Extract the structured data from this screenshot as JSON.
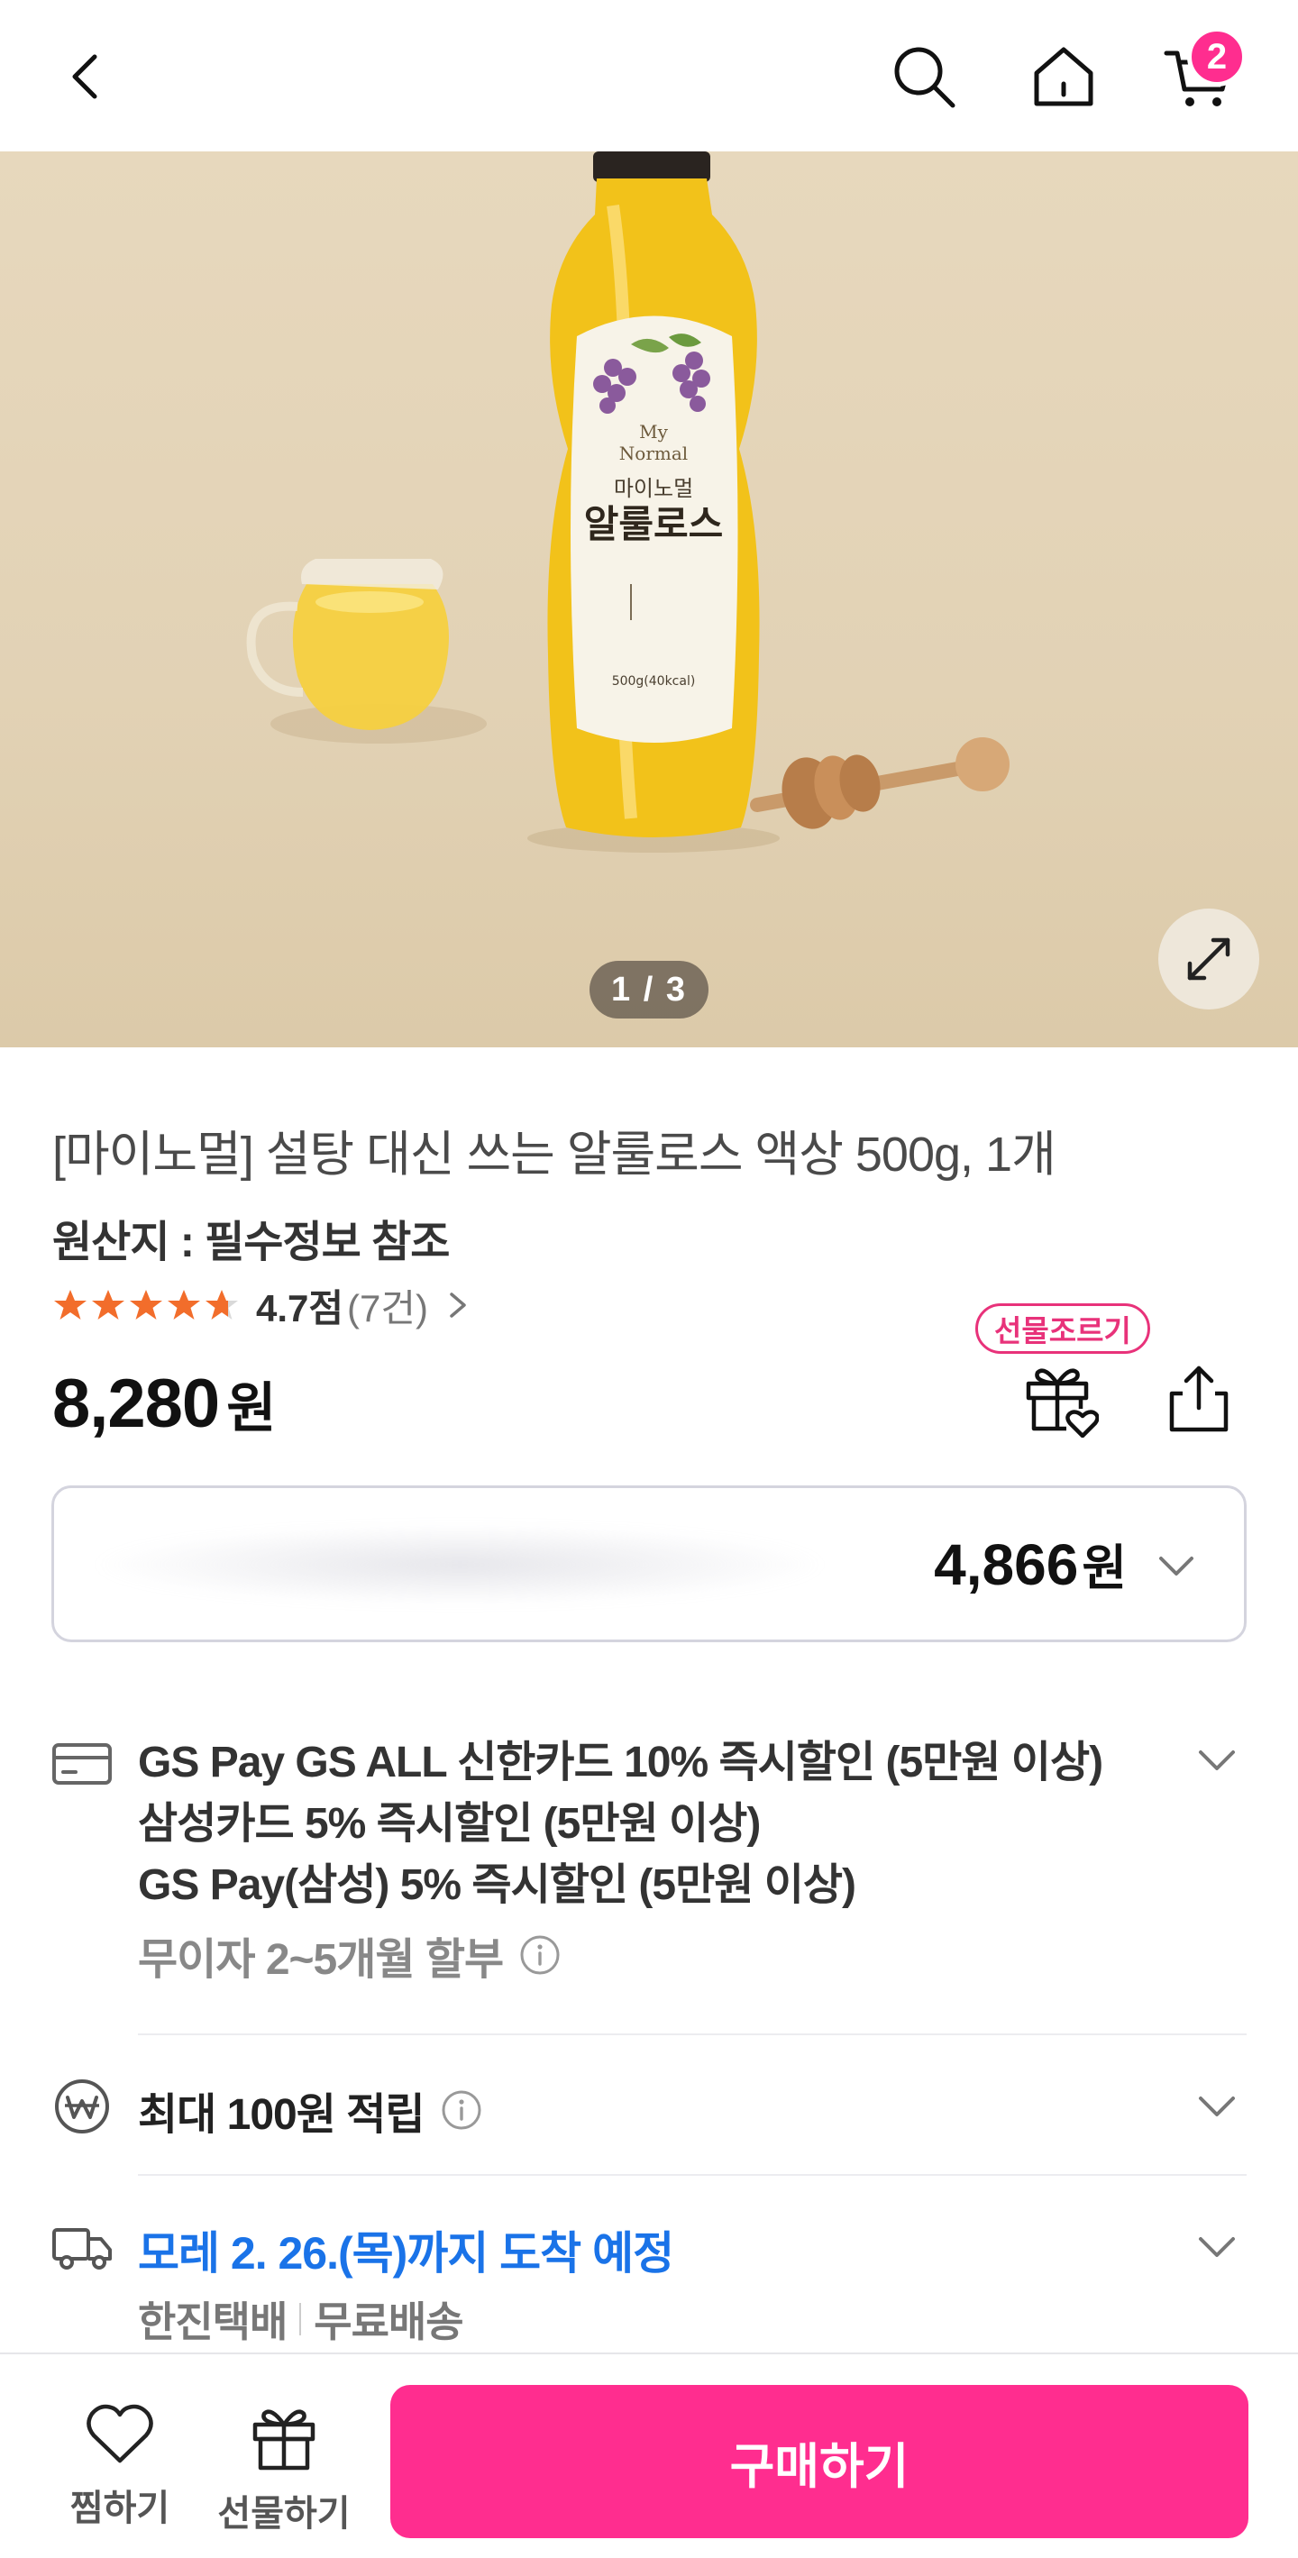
{
  "header": {
    "back_icon": "chevron-left-icon",
    "search_icon": "search-icon",
    "home_icon": "home-icon",
    "cart_icon": "cart-icon",
    "cart_count": "2"
  },
  "gallery": {
    "page_indicator": "1 / 3",
    "image_label_brand": "My\nNormal",
    "image_label_kr_small": "마이노멀",
    "image_label_kr_big": "알룰로스",
    "image_label_weight": "500g(40kcal)"
  },
  "product": {
    "title": "[마이노멀] 설탕 대신 쓰는 알룰로스 액상 500g, 1개",
    "origin": "원산지 : 필수정보 참조",
    "rating_score": "4.7점",
    "rating_count": "(7건)",
    "rating_value": 4.7,
    "rating_max": 5,
    "price": "8,280",
    "price_unit": "원",
    "gift_badge": "선물조르기"
  },
  "discount": {
    "price": "4,866",
    "unit": "원"
  },
  "benefits": {
    "card_lines": [
      "GS Pay GS ALL 신한카드 10% 즉시할인 (5만원 이상)",
      "삼성카드 5% 즉시할인 (5만원 이상)",
      "GS Pay(삼성) 5% 즉시할인 (5만원 이상)"
    ],
    "installment": "무이자 2~5개월 할부",
    "points": "최대 100원 적립",
    "delivery_date": "모레 2. 26.(목)까지 도착 예정",
    "courier": "한진택배",
    "shipping": "무료배송"
  },
  "bottom_bar": {
    "like_label": "찜하기",
    "gift_label": "선물하기",
    "buy_label": "구매하기"
  },
  "colors": {
    "accent": "#ff2d8f",
    "delivery_blue": "#1a73e8",
    "star_orange": "#f26d2b"
  }
}
